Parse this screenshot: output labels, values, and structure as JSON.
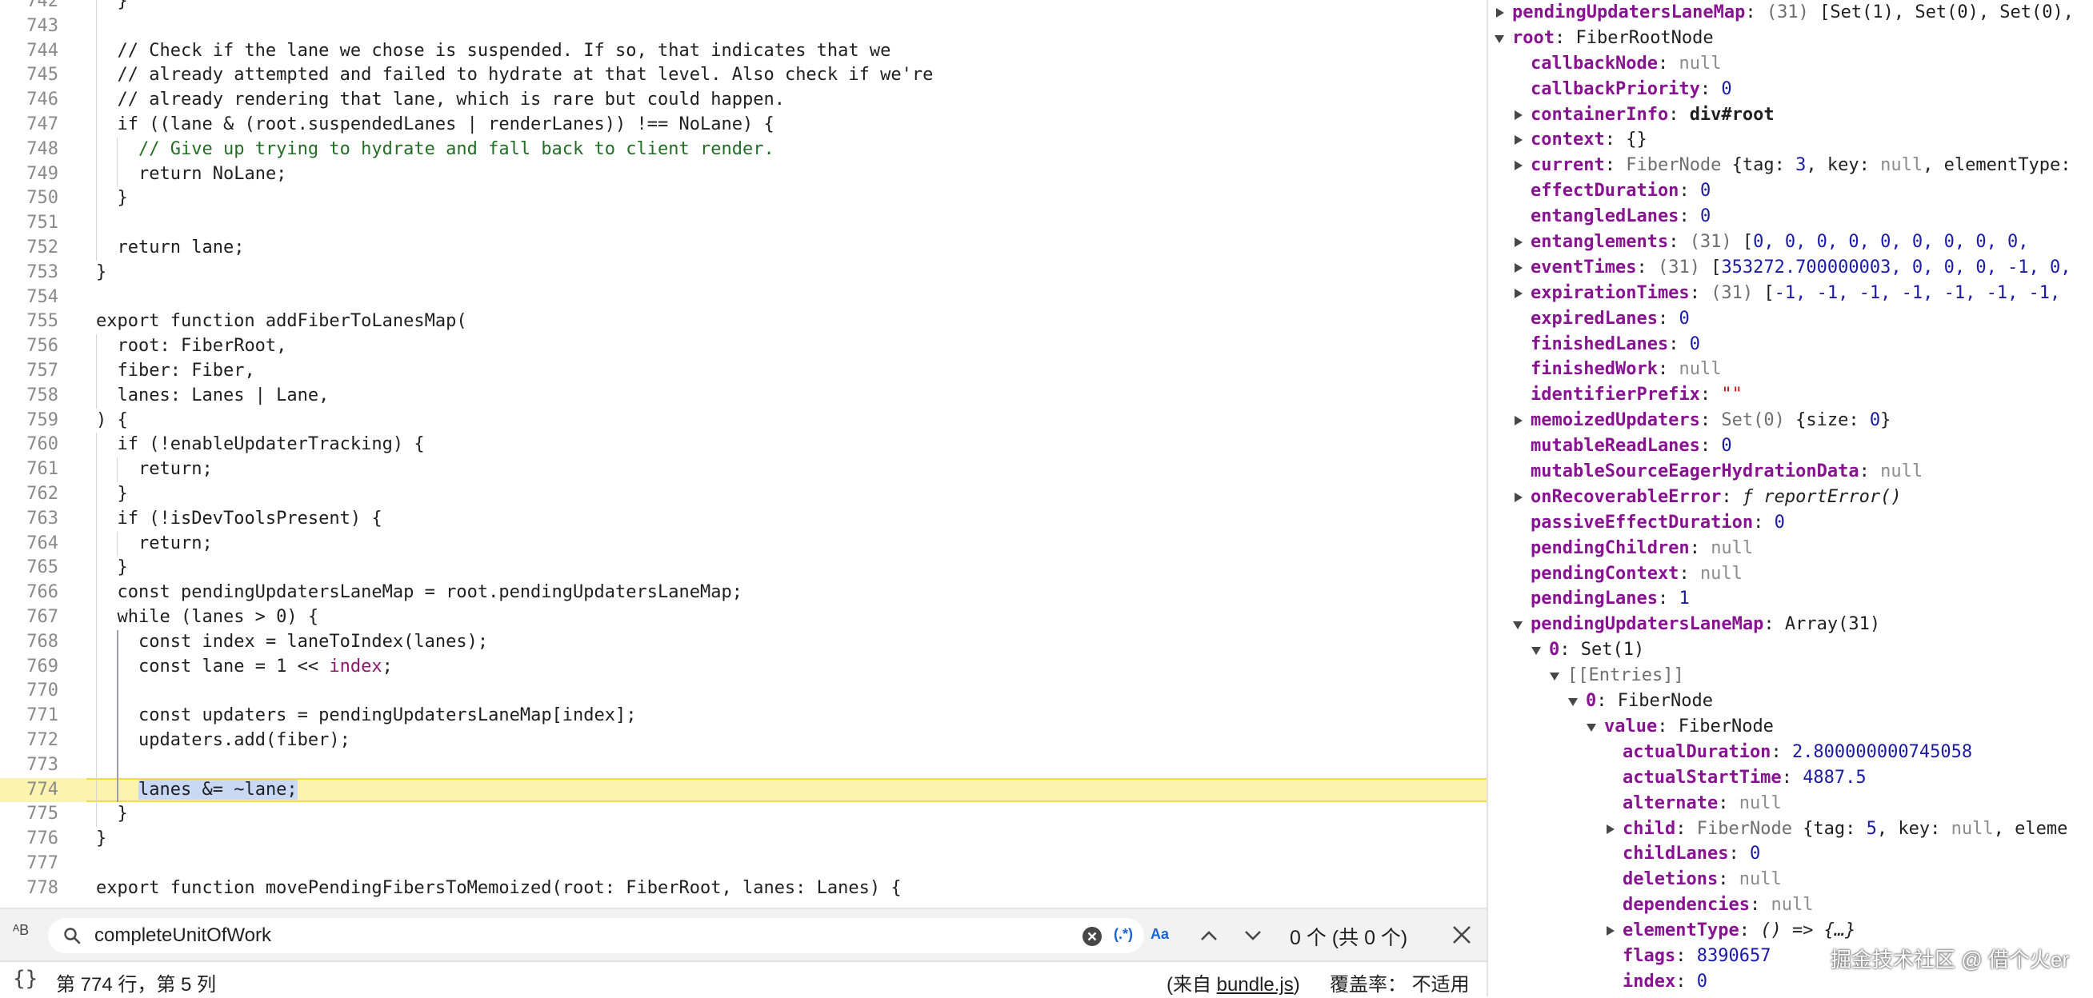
{
  "editor": {
    "lines": [
      {
        "n": "742",
        "indent": 1,
        "parts": [
          {
            "t": "}",
            "c": "cm"
          }
        ]
      },
      {
        "n": "743",
        "indent": 0,
        "parts": []
      },
      {
        "n": "744",
        "indent": 1,
        "parts": [
          {
            "t": "// Check if the lane we chose is suspended. If so, that indicates that we",
            "c": "cm"
          }
        ]
      },
      {
        "n": "745",
        "indent": 1,
        "parts": [
          {
            "t": "// already attempted and failed to hydrate at that level. Also check if we're",
            "c": "cm"
          }
        ]
      },
      {
        "n": "746",
        "indent": 1,
        "parts": [
          {
            "t": "// already rendering that lane, which is rare but could happen.",
            "c": "cm"
          }
        ]
      },
      {
        "n": "747",
        "indent": 1,
        "parts": [
          {
            "t": "if ((lane & (root.suspendedLanes | renderLanes)) !== NoLane) {",
            "c": "cm"
          }
        ]
      },
      {
        "n": "748",
        "indent": 2,
        "parts": [
          {
            "t": "// Give up trying to hydrate and fall back to client render.",
            "c": "cm-green"
          }
        ]
      },
      {
        "n": "749",
        "indent": 2,
        "parts": [
          {
            "t": "return NoLane;",
            "c": "cm"
          }
        ]
      },
      {
        "n": "750",
        "indent": 1,
        "parts": [
          {
            "t": "}",
            "c": "cm"
          }
        ]
      },
      {
        "n": "751",
        "indent": 0,
        "parts": []
      },
      {
        "n": "752",
        "indent": 1,
        "parts": [
          {
            "t": "return lane;",
            "c": "cm"
          }
        ]
      },
      {
        "n": "753",
        "indent": 0,
        "parts": [
          {
            "t": "}",
            "c": "cm"
          }
        ]
      },
      {
        "n": "754",
        "indent": 0,
        "parts": []
      },
      {
        "n": "755",
        "indent": 0,
        "parts": [
          {
            "t": "export function addFiberToLanesMap(",
            "c": "cm"
          }
        ]
      },
      {
        "n": "756",
        "indent": 1,
        "parts": [
          {
            "t": "root: FiberRoot,",
            "c": "cm"
          }
        ]
      },
      {
        "n": "757",
        "indent": 1,
        "parts": [
          {
            "t": "fiber: Fiber,",
            "c": "cm"
          }
        ]
      },
      {
        "n": "758",
        "indent": 1,
        "parts": [
          {
            "t": "lanes: Lanes | Lane,",
            "c": "cm"
          }
        ]
      },
      {
        "n": "759",
        "indent": 0,
        "parts": [
          {
            "t": ") {",
            "c": "cm"
          }
        ]
      },
      {
        "n": "760",
        "indent": 1,
        "parts": [
          {
            "t": "if (!enableUpdaterTracking) {",
            "c": "cm"
          }
        ]
      },
      {
        "n": "761",
        "indent": 2,
        "parts": [
          {
            "t": "return;",
            "c": "cm"
          }
        ]
      },
      {
        "n": "762",
        "indent": 1,
        "parts": [
          {
            "t": "}",
            "c": "cm"
          }
        ]
      },
      {
        "n": "763",
        "indent": 1,
        "parts": [
          {
            "t": "if (!isDevToolsPresent) {",
            "c": "cm"
          }
        ]
      },
      {
        "n": "764",
        "indent": 2,
        "parts": [
          {
            "t": "return;",
            "c": "cm"
          }
        ]
      },
      {
        "n": "765",
        "indent": 1,
        "parts": [
          {
            "t": "}",
            "c": "cm"
          }
        ]
      },
      {
        "n": "766",
        "indent": 1,
        "parts": [
          {
            "t": "const pendingUpdatersLaneMap = root.pendingUpdatersLaneMap;",
            "c": "cm"
          }
        ]
      },
      {
        "n": "767",
        "indent": 1,
        "parts": [
          {
            "t": "while (lanes > 0) {",
            "c": "cm"
          }
        ]
      },
      {
        "n": "768",
        "indent": 2,
        "parts": [
          {
            "t": "const index = laneToIndex(lanes);",
            "c": "cm"
          }
        ]
      },
      {
        "n": "769",
        "indent": 2,
        "parts": [
          {
            "t": "const lane = 1 << ",
            "c": "cm"
          },
          {
            "t": "index",
            "c": "kw-purple"
          },
          {
            "t": ";",
            "c": "cm"
          }
        ]
      },
      {
        "n": "770",
        "indent": 0,
        "parts": []
      },
      {
        "n": "771",
        "indent": 2,
        "parts": [
          {
            "t": "const updaters = pendingUpdatersLaneMap[index];",
            "c": "cm"
          }
        ]
      },
      {
        "n": "772",
        "indent": 2,
        "parts": [
          {
            "t": "updaters.add(fiber);",
            "c": "cm"
          }
        ]
      },
      {
        "n": "773",
        "indent": 0,
        "parts": []
      },
      {
        "n": "774",
        "indent": 2,
        "hl": true,
        "parts": [
          {
            "t": "lanes &= ~lane;",
            "c": "sel"
          }
        ]
      },
      {
        "n": "775",
        "indent": 1,
        "parts": [
          {
            "t": "}",
            "c": "cm"
          }
        ]
      },
      {
        "n": "776",
        "indent": 0,
        "parts": [
          {
            "t": "}",
            "c": "cm"
          }
        ]
      },
      {
        "n": "777",
        "indent": 0,
        "parts": []
      },
      {
        "n": "778",
        "indent": 0,
        "parts": [
          {
            "t": "export function movePendingFibersToMemoized(root: FiberRoot, lanes: Lanes) {",
            "c": "cm"
          }
        ]
      }
    ]
  },
  "search": {
    "query": "completeUnitOfWork",
    "regex_label": "(.*)",
    "case_label": "Aa",
    "count": "0 个 (共 0 个)",
    "bracket_icon": "{}",
    "ab_icon": "ᴬB"
  },
  "status": {
    "position": "第 774 行，第 5 列",
    "source_prefix": "(来自 ",
    "source_file": "bundle.js",
    "source_suffix": ")",
    "coverage": "覆盖率： 不适用"
  },
  "scope": {
    "rows": [
      {
        "i": 0,
        "tri": "r",
        "parts": [
          {
            "t": "pendingUpdatersLaneMap",
            "c": "k"
          },
          {
            "t": ": ",
            "c": "obj"
          },
          {
            "t": "(31) ",
            "c": "dim"
          },
          {
            "t": "[Set(1), Set(0), Set(0),",
            "c": "obj"
          }
        ]
      },
      {
        "i": 0,
        "tri": "d",
        "parts": [
          {
            "t": "root",
            "c": "k"
          },
          {
            "t": ": FiberRootNode",
            "c": "obj"
          }
        ]
      },
      {
        "i": 1,
        "tri": "",
        "parts": [
          {
            "t": "callbackNode",
            "c": "k"
          },
          {
            "t": ": ",
            "c": "obj"
          },
          {
            "t": "null",
            "c": "nul"
          }
        ]
      },
      {
        "i": 1,
        "tri": "",
        "parts": [
          {
            "t": "callbackPriority",
            "c": "k"
          },
          {
            "t": ": ",
            "c": "obj"
          },
          {
            "t": "0",
            "c": "num"
          }
        ]
      },
      {
        "i": 1,
        "tri": "r",
        "parts": [
          {
            "t": "containerInfo",
            "c": "k"
          },
          {
            "t": ": ",
            "c": "obj"
          },
          {
            "t": "div#root",
            "c": "k plain"
          }
        ]
      },
      {
        "i": 1,
        "tri": "r",
        "parts": [
          {
            "t": "context",
            "c": "k"
          },
          {
            "t": ": {}",
            "c": "obj"
          }
        ]
      },
      {
        "i": 1,
        "tri": "r",
        "parts": [
          {
            "t": "current",
            "c": "k"
          },
          {
            "t": ": ",
            "c": "obj"
          },
          {
            "t": "FiberNode ",
            "c": "dim"
          },
          {
            "t": "{tag: ",
            "c": "obj"
          },
          {
            "t": "3",
            "c": "num"
          },
          {
            "t": ", key: ",
            "c": "obj"
          },
          {
            "t": "null",
            "c": "nul"
          },
          {
            "t": ", elementType:",
            "c": "obj"
          }
        ]
      },
      {
        "i": 1,
        "tri": "",
        "parts": [
          {
            "t": "effectDuration",
            "c": "k"
          },
          {
            "t": ": ",
            "c": "obj"
          },
          {
            "t": "0",
            "c": "num"
          }
        ]
      },
      {
        "i": 1,
        "tri": "",
        "parts": [
          {
            "t": "entangledLanes",
            "c": "k"
          },
          {
            "t": ": ",
            "c": "obj"
          },
          {
            "t": "0",
            "c": "num"
          }
        ]
      },
      {
        "i": 1,
        "tri": "r",
        "parts": [
          {
            "t": "entanglements",
            "c": "k"
          },
          {
            "t": ": ",
            "c": "obj"
          },
          {
            "t": "(31) ",
            "c": "dim"
          },
          {
            "t": "[",
            "c": "obj"
          },
          {
            "t": "0, 0, 0, 0, 0, 0, 0, 0, 0,",
            "c": "num"
          }
        ]
      },
      {
        "i": 1,
        "tri": "r",
        "parts": [
          {
            "t": "eventTimes",
            "c": "k"
          },
          {
            "t": ": ",
            "c": "obj"
          },
          {
            "t": "(31) ",
            "c": "dim"
          },
          {
            "t": "[",
            "c": "obj"
          },
          {
            "t": "353272.700000003, 0, 0, 0, -1, 0,",
            "c": "num"
          }
        ]
      },
      {
        "i": 1,
        "tri": "r",
        "parts": [
          {
            "t": "expirationTimes",
            "c": "k"
          },
          {
            "t": ": ",
            "c": "obj"
          },
          {
            "t": "(31) ",
            "c": "dim"
          },
          {
            "t": "[",
            "c": "obj"
          },
          {
            "t": "-1, -1, -1, -1, -1, -1, -1,",
            "c": "num"
          }
        ]
      },
      {
        "i": 1,
        "tri": "",
        "parts": [
          {
            "t": "expiredLanes",
            "c": "k"
          },
          {
            "t": ": ",
            "c": "obj"
          },
          {
            "t": "0",
            "c": "num"
          }
        ]
      },
      {
        "i": 1,
        "tri": "",
        "parts": [
          {
            "t": "finishedLanes",
            "c": "k"
          },
          {
            "t": ": ",
            "c": "obj"
          },
          {
            "t": "0",
            "c": "num"
          }
        ]
      },
      {
        "i": 1,
        "tri": "",
        "parts": [
          {
            "t": "finishedWork",
            "c": "k"
          },
          {
            "t": ": ",
            "c": "obj"
          },
          {
            "t": "null",
            "c": "nul"
          }
        ]
      },
      {
        "i": 1,
        "tri": "",
        "parts": [
          {
            "t": "identifierPrefix",
            "c": "k"
          },
          {
            "t": ": ",
            "c": "obj"
          },
          {
            "t": "\"\"",
            "c": "str"
          }
        ]
      },
      {
        "i": 1,
        "tri": "r",
        "parts": [
          {
            "t": "memoizedUpdaters",
            "c": "k"
          },
          {
            "t": ": ",
            "c": "obj"
          },
          {
            "t": "Set(0) ",
            "c": "dim"
          },
          {
            "t": "{size: ",
            "c": "obj"
          },
          {
            "t": "0",
            "c": "num"
          },
          {
            "t": "}",
            "c": "obj"
          }
        ]
      },
      {
        "i": 1,
        "tri": "",
        "parts": [
          {
            "t": "mutableReadLanes",
            "c": "k"
          },
          {
            "t": ": ",
            "c": "obj"
          },
          {
            "t": "0",
            "c": "num"
          }
        ]
      },
      {
        "i": 1,
        "tri": "",
        "parts": [
          {
            "t": "mutableSourceEagerHydrationData",
            "c": "k"
          },
          {
            "t": ": ",
            "c": "obj"
          },
          {
            "t": "null",
            "c": "nul"
          }
        ]
      },
      {
        "i": 1,
        "tri": "r",
        "parts": [
          {
            "t": "onRecoverableError",
            "c": "k"
          },
          {
            "t": ": ",
            "c": "obj"
          },
          {
            "t": "ƒ reportError()",
            "c": "fn"
          }
        ]
      },
      {
        "i": 1,
        "tri": "",
        "parts": [
          {
            "t": "passiveEffectDuration",
            "c": "k"
          },
          {
            "t": ": ",
            "c": "obj"
          },
          {
            "t": "0",
            "c": "num"
          }
        ]
      },
      {
        "i": 1,
        "tri": "",
        "parts": [
          {
            "t": "pendingChildren",
            "c": "k"
          },
          {
            "t": ": ",
            "c": "obj"
          },
          {
            "t": "null",
            "c": "nul"
          }
        ]
      },
      {
        "i": 1,
        "tri": "",
        "parts": [
          {
            "t": "pendingContext",
            "c": "k"
          },
          {
            "t": ": ",
            "c": "obj"
          },
          {
            "t": "null",
            "c": "nul"
          }
        ]
      },
      {
        "i": 1,
        "tri": "",
        "parts": [
          {
            "t": "pendingLanes",
            "c": "k"
          },
          {
            "t": ": ",
            "c": "obj"
          },
          {
            "t": "1",
            "c": "num"
          }
        ]
      },
      {
        "i": 1,
        "tri": "d",
        "parts": [
          {
            "t": "pendingUpdatersLaneMap",
            "c": "k"
          },
          {
            "t": ": Array(31)",
            "c": "obj"
          }
        ]
      },
      {
        "i": 2,
        "tri": "d",
        "parts": [
          {
            "t": "0",
            "c": "k"
          },
          {
            "t": ": Set(1)",
            "c": "obj"
          }
        ]
      },
      {
        "i": 3,
        "tri": "d",
        "parts": [
          {
            "t": "[[Entries]]",
            "c": "dim"
          }
        ]
      },
      {
        "i": 4,
        "tri": "d",
        "parts": [
          {
            "t": "0",
            "c": "k"
          },
          {
            "t": ": FiberNode",
            "c": "obj"
          }
        ]
      },
      {
        "i": 5,
        "tri": "d",
        "parts": [
          {
            "t": "value",
            "c": "k"
          },
          {
            "t": ": FiberNode",
            "c": "obj"
          }
        ]
      },
      {
        "i": 6,
        "tri": "",
        "parts": [
          {
            "t": "actualDuration",
            "c": "k"
          },
          {
            "t": ": ",
            "c": "obj"
          },
          {
            "t": "2.800000000745058",
            "c": "num"
          }
        ]
      },
      {
        "i": 6,
        "tri": "",
        "parts": [
          {
            "t": "actualStartTime",
            "c": "k"
          },
          {
            "t": ": ",
            "c": "obj"
          },
          {
            "t": "4887.5",
            "c": "num"
          }
        ]
      },
      {
        "i": 6,
        "tri": "",
        "parts": [
          {
            "t": "alternate",
            "c": "k"
          },
          {
            "t": ": ",
            "c": "obj"
          },
          {
            "t": "null",
            "c": "nul"
          }
        ]
      },
      {
        "i": 6,
        "tri": "r",
        "parts": [
          {
            "t": "child",
            "c": "k"
          },
          {
            "t": ": ",
            "c": "obj"
          },
          {
            "t": "FiberNode ",
            "c": "dim"
          },
          {
            "t": "{tag: ",
            "c": "obj"
          },
          {
            "t": "5",
            "c": "num"
          },
          {
            "t": ", key: ",
            "c": "obj"
          },
          {
            "t": "null",
            "c": "nul"
          },
          {
            "t": ", eleme",
            "c": "obj"
          }
        ]
      },
      {
        "i": 6,
        "tri": "",
        "parts": [
          {
            "t": "childLanes",
            "c": "k"
          },
          {
            "t": ": ",
            "c": "obj"
          },
          {
            "t": "0",
            "c": "num"
          }
        ]
      },
      {
        "i": 6,
        "tri": "",
        "parts": [
          {
            "t": "deletions",
            "c": "k"
          },
          {
            "t": ": ",
            "c": "obj"
          },
          {
            "t": "null",
            "c": "nul"
          }
        ]
      },
      {
        "i": 6,
        "tri": "",
        "parts": [
          {
            "t": "dependencies",
            "c": "k"
          },
          {
            "t": ": ",
            "c": "obj"
          },
          {
            "t": "null",
            "c": "nul"
          }
        ]
      },
      {
        "i": 6,
        "tri": "r",
        "parts": [
          {
            "t": "elementType",
            "c": "k"
          },
          {
            "t": ": ",
            "c": "obj"
          },
          {
            "t": "() => {…}",
            "c": "fn"
          }
        ]
      },
      {
        "i": 6,
        "tri": "",
        "parts": [
          {
            "t": "flags",
            "c": "k"
          },
          {
            "t": ": ",
            "c": "obj"
          },
          {
            "t": "8390657",
            "c": "num"
          }
        ]
      },
      {
        "i": 6,
        "tri": "",
        "parts": [
          {
            "t": "index",
            "c": "k"
          },
          {
            "t": ": ",
            "c": "obj"
          },
          {
            "t": "0",
            "c": "num"
          }
        ]
      }
    ]
  },
  "watermark": "掘金技术社区 @ 借个火er"
}
